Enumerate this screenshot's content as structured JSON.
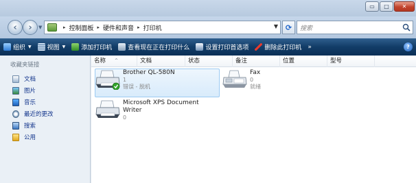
{
  "window": {
    "buttons": {
      "minimize": "▭",
      "maximize": "□",
      "close": "✕"
    }
  },
  "address": {
    "breadcrumbs": [
      "控制面板",
      "硬件和声音",
      "打印机"
    ],
    "separator": "▸",
    "search_placeholder": "搜索"
  },
  "toolbar": {
    "items": [
      {
        "label": "组织",
        "icon": "organize-icon",
        "has_dropdown": true
      },
      {
        "label": "视图",
        "icon": "views-icon",
        "has_dropdown": true
      },
      {
        "label": "添加打印机",
        "icon": "add-printer-icon",
        "has_dropdown": false
      },
      {
        "label": "查看现在正在打印什么",
        "icon": "print-queue-icon",
        "has_dropdown": false
      },
      {
        "label": "设置打印首选项",
        "icon": "printing-preferences-icon",
        "has_dropdown": false
      },
      {
        "label": "删除此打印机",
        "icon": "delete-icon",
        "has_dropdown": false
      },
      {
        "label": "»",
        "icon": "",
        "has_dropdown": false
      }
    ],
    "help": "?"
  },
  "navigation": {
    "title": "收藏夹链接",
    "items": [
      {
        "label": "文档",
        "icon": "documents-icon"
      },
      {
        "label": "图片",
        "icon": "pictures-icon"
      },
      {
        "label": "音乐",
        "icon": "music-icon"
      },
      {
        "label": "最近的更改",
        "icon": "recent-changes-icon"
      },
      {
        "label": "搜索",
        "icon": "searches-icon"
      },
      {
        "label": "公用",
        "icon": "public-folder-icon"
      }
    ]
  },
  "columns": [
    "名称",
    "文档",
    "状态",
    "备注",
    "位置",
    "型号"
  ],
  "sort_indicator": "^",
  "printers": [
    {
      "name": "Brother QL-580N",
      "documents": "1",
      "status": "错误 - 脱机",
      "selected": true,
      "has_check": true
    },
    {
      "name": "Fax",
      "documents": "0",
      "status": "就绪",
      "selected": false,
      "has_check": false
    },
    {
      "name_line1": "Microsoft XPS Document",
      "name_line2": "Writer",
      "documents": "0",
      "status": "",
      "selected": false,
      "has_check": false
    }
  ],
  "colors": {
    "accent": "#1d5fb9",
    "toolbar_bg": "#123c67",
    "selection": "#d8ebfb",
    "nav_link": "#13358c"
  }
}
